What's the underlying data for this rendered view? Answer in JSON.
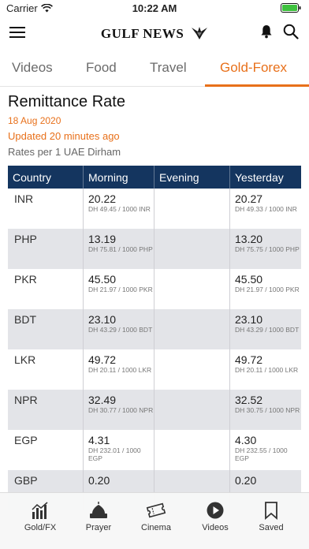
{
  "status_bar": {
    "carrier": "Carrier",
    "time": "10:22 AM"
  },
  "header": {
    "brand": "GULF NEWS"
  },
  "tabs": [
    {
      "label": "Videos",
      "active": false
    },
    {
      "label": "Food",
      "active": false
    },
    {
      "label": "Travel",
      "active": false
    },
    {
      "label": "Gold-Forex",
      "active": true
    }
  ],
  "page": {
    "title": "Remittance Rate",
    "date": "18 Aug 2020",
    "updated": "Updated 20 minutes ago",
    "note": "Rates per 1 UAE Dirham"
  },
  "table": {
    "headers": [
      "Country",
      "Morning",
      "Evening",
      "Yesterday"
    ],
    "rows": [
      {
        "country": "INR",
        "morning": "20.22",
        "morning_sub": "DH 49.45 / 1000 INR",
        "evening": "",
        "yesterday": "20.27",
        "yesterday_sub": "DH 49.33 / 1000 INR"
      },
      {
        "country": "PHP",
        "morning": "13.19",
        "morning_sub": "DH 75.81 / 1000 PHP",
        "evening": "",
        "yesterday": "13.20",
        "yesterday_sub": "DH 75.75 / 1000 PHP"
      },
      {
        "country": "PKR",
        "morning": "45.50",
        "morning_sub": "DH 21.97 / 1000 PKR",
        "evening": "",
        "yesterday": "45.50",
        "yesterday_sub": "DH 21.97 / 1000 PKR"
      },
      {
        "country": "BDT",
        "morning": "23.10",
        "morning_sub": "DH 43.29 / 1000 BDT",
        "evening": "",
        "yesterday": "23.10",
        "yesterday_sub": "DH 43.29 / 1000 BDT"
      },
      {
        "country": "LKR",
        "morning": "49.72",
        "morning_sub": "DH 20.11 / 1000 LKR",
        "evening": "",
        "yesterday": "49.72",
        "yesterday_sub": "DH 20.11 / 1000 LKR"
      },
      {
        "country": "NPR",
        "morning": "32.49",
        "morning_sub": "DH 30.77 / 1000 NPR",
        "evening": "",
        "yesterday": "32.52",
        "yesterday_sub": "DH 30.75 / 1000 NPR"
      },
      {
        "country": "EGP",
        "morning": "4.31",
        "morning_sub": "DH 232.01 / 1000 EGP",
        "evening": "",
        "yesterday": "4.30",
        "yesterday_sub": "DH 232.55 / 1000 EGP"
      },
      {
        "country": "GBP",
        "morning": "0.20",
        "morning_sub": "",
        "evening": "",
        "yesterday": "0.20",
        "yesterday_sub": ""
      }
    ]
  },
  "bottom_nav": [
    {
      "label": "Gold/FX",
      "icon": "chart-bars-icon"
    },
    {
      "label": "Prayer",
      "icon": "mosque-icon"
    },
    {
      "label": "Cinema",
      "icon": "ticket-icon"
    },
    {
      "label": "Videos",
      "icon": "play-circle-icon"
    },
    {
      "label": "Saved",
      "icon": "bookmark-icon"
    }
  ],
  "colors": {
    "accent": "#e8701a",
    "table_header": "#14355f",
    "row_alt": "#e3e4e8"
  }
}
